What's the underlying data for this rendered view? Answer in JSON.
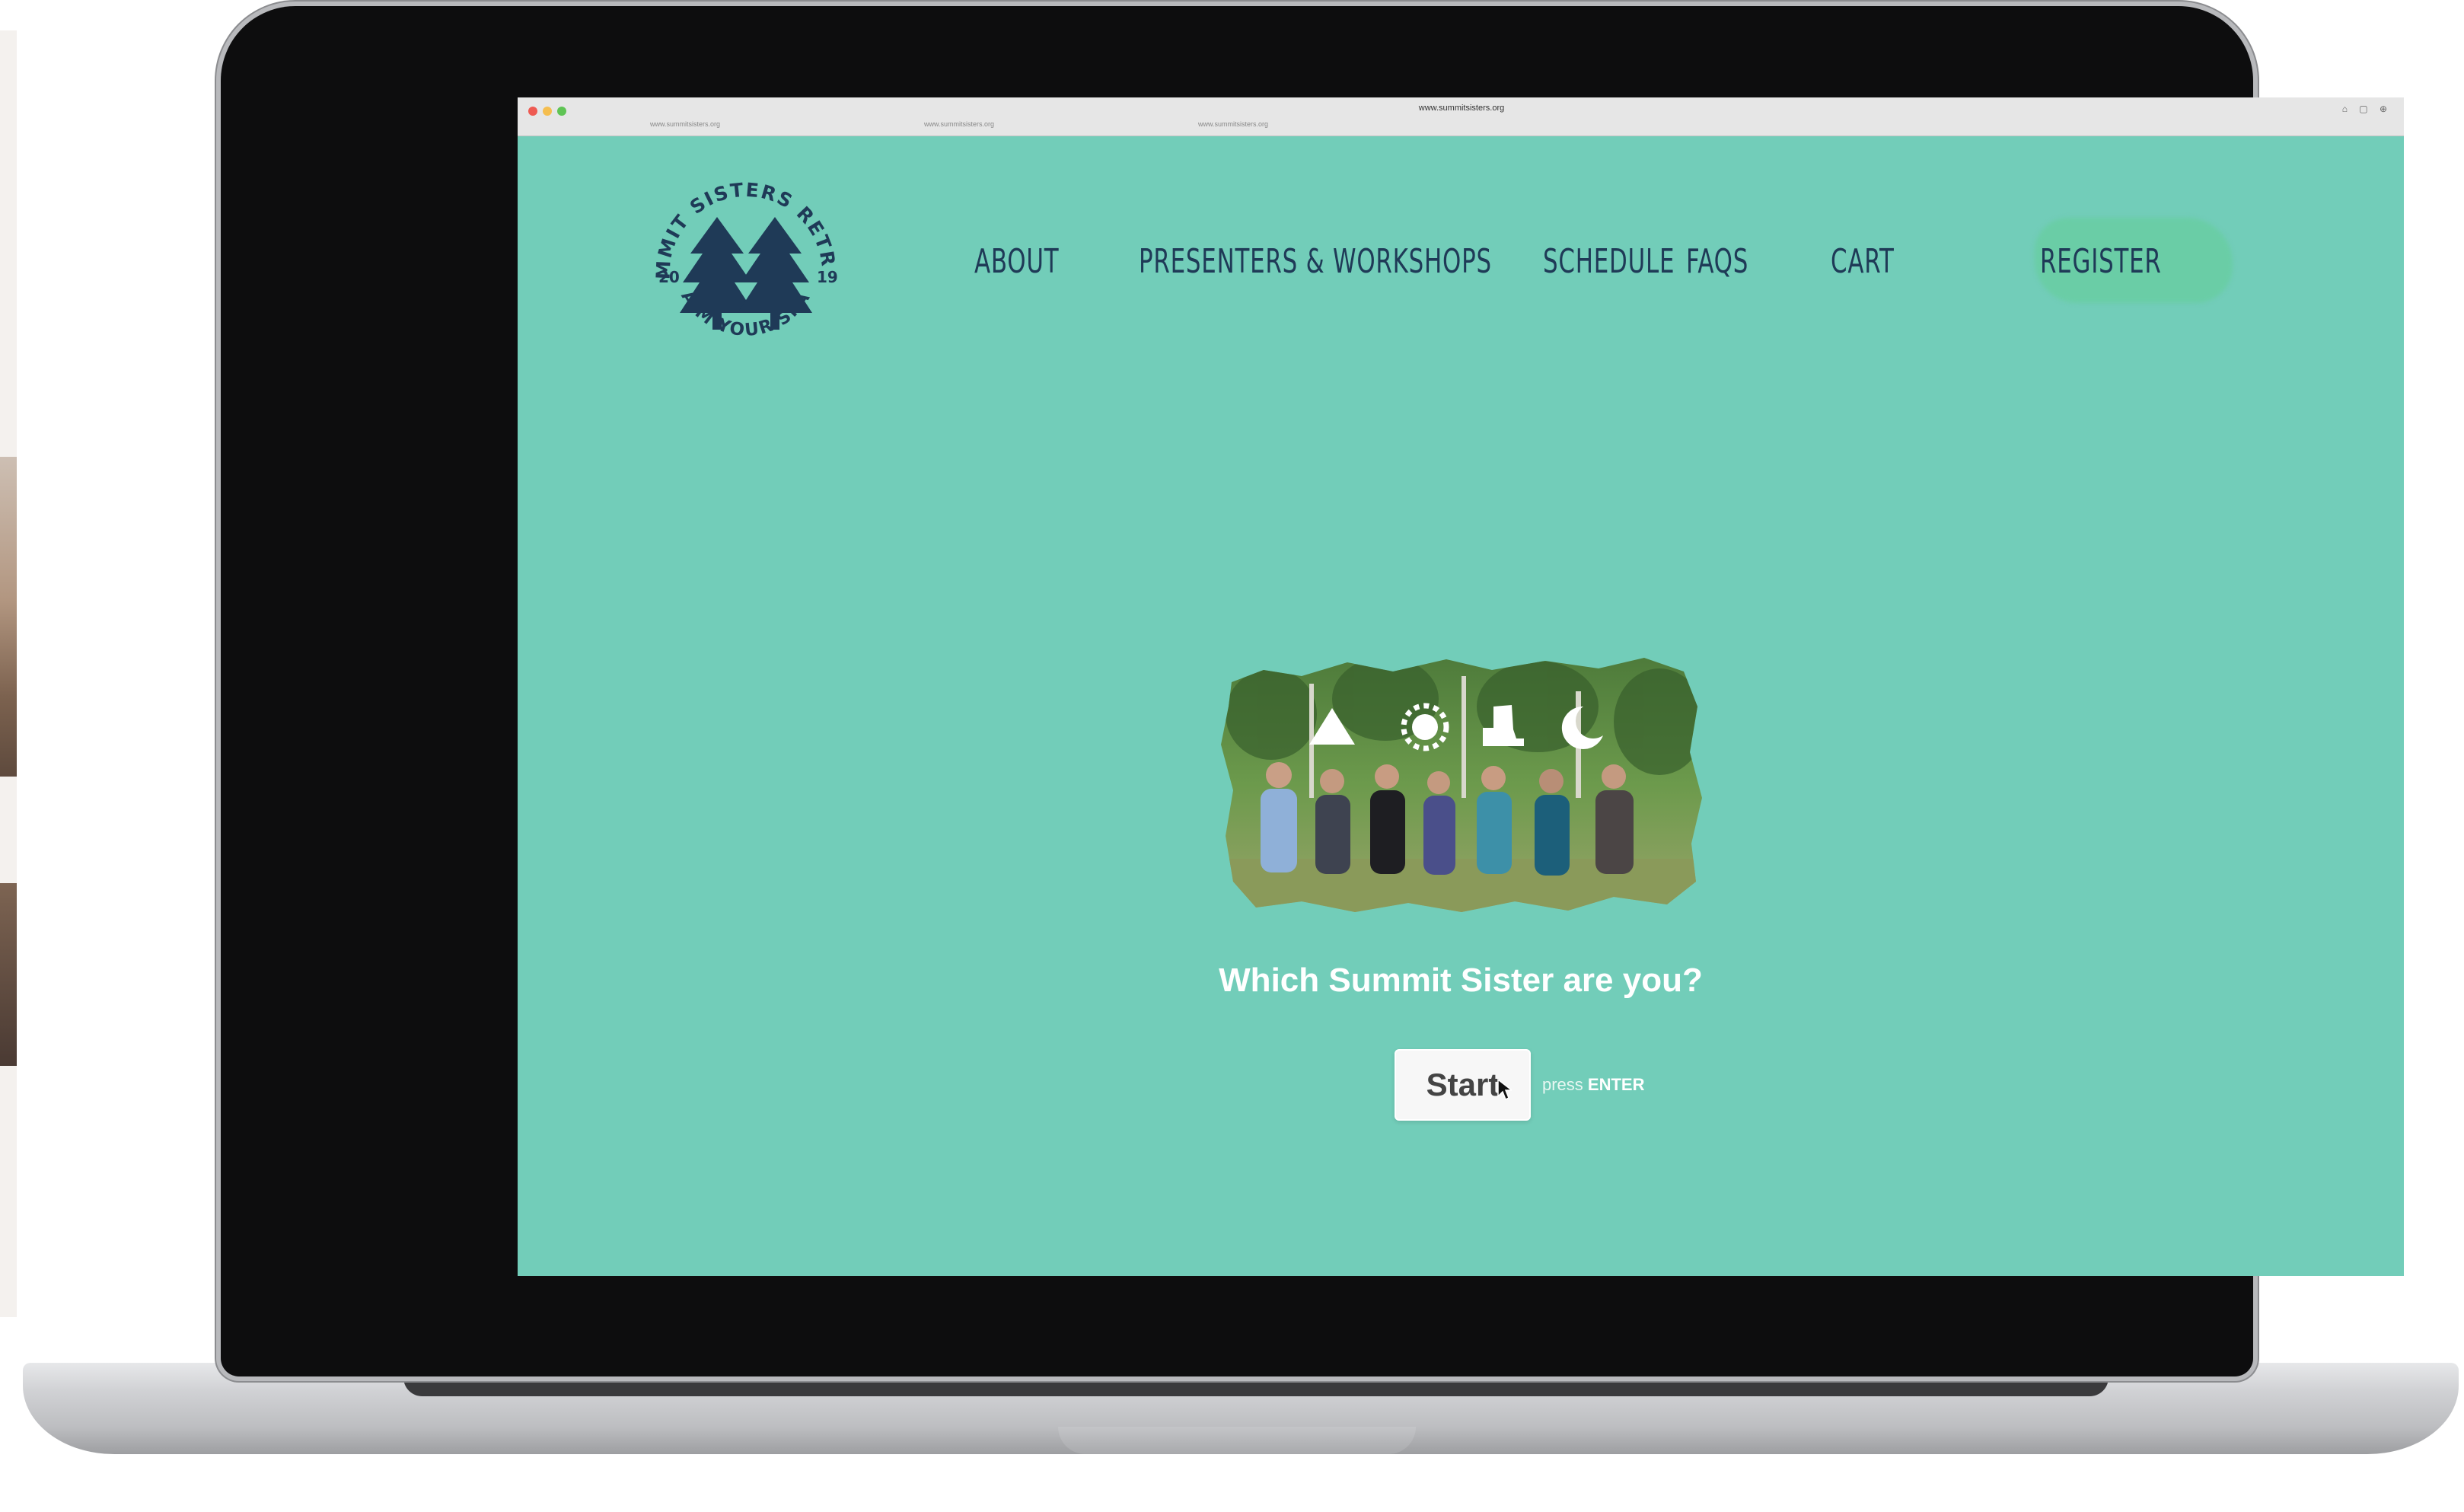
{
  "browser": {
    "url": "www.summitsisters.org",
    "tabs": [
      "www.summitsisters.org",
      "www.summitsisters.org",
      "www.summitsisters.org"
    ]
  },
  "logo": {
    "top_text": "SUMMIT SISTERS RETREAT",
    "bottom_text": "CLAIM YOUR SPACE",
    "year_left": "20",
    "year_right": "19"
  },
  "nav": {
    "items": [
      {
        "label": "ABOUT"
      },
      {
        "label": "PRESENTERS & WORKSHOPS"
      },
      {
        "label": "SCHEDULE"
      },
      {
        "label": "FAQS"
      },
      {
        "label": "CART"
      },
      {
        "label": "REGISTER"
      }
    ]
  },
  "hero": {
    "icons": [
      "mountain-icon",
      "sun-icon",
      "hiking-boot-icon",
      "moon-icon"
    ],
    "question": "Which Summit Sister are you?",
    "start_label": "Start",
    "press_label": "press",
    "enter_label": "ENTER"
  },
  "colors": {
    "background": "#72cdb9",
    "navy": "#1f3a57",
    "register_highlight": "#6acda6"
  }
}
